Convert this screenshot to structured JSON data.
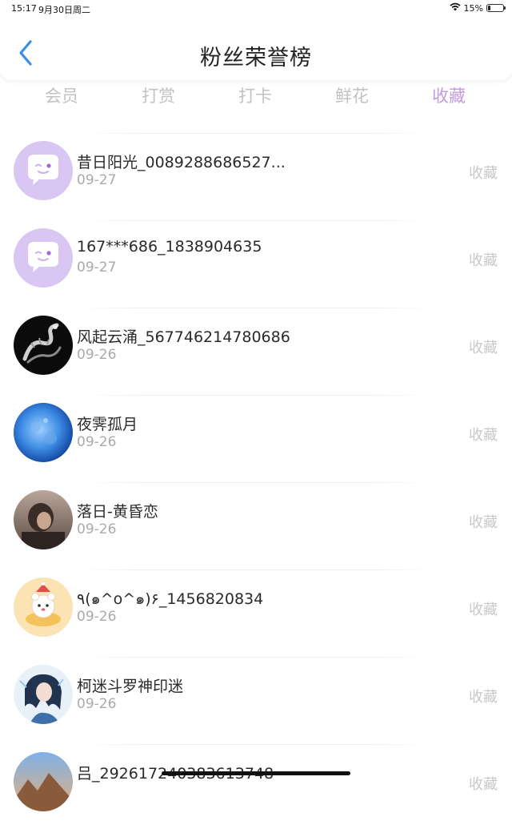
{
  "status_bar": {
    "time": "15:17",
    "date": "9月30日周二",
    "battery": "15%",
    "battery_level": 0.15
  },
  "header": {
    "title": "粉丝荣誉榜"
  },
  "tabs": [
    {
      "label": "会员"
    },
    {
      "label": "打赏"
    },
    {
      "label": "打卡"
    },
    {
      "label": "鲜花"
    },
    {
      "label": "收藏"
    }
  ],
  "active_tab": "收藏",
  "colors": {
    "accent": "#c39be0",
    "back_arrow": "#3a8ee6",
    "muted_text": "#c8c8c8"
  },
  "list": [
    {
      "name": "昔日阳光_0089288686527...",
      "date": "09-27",
      "action": "收藏",
      "avatar": "purple-chat-bubble-avatar"
    },
    {
      "name": "167***686_1838904635",
      "date": "09-27",
      "action": "收藏",
      "avatar": "purple-chat-bubble-avatar"
    },
    {
      "name": "风起云涌_567746214780686",
      "date": "09-26",
      "action": "收藏",
      "avatar": "dragon-avatar"
    },
    {
      "name": "夜霁孤月",
      "date": "09-26",
      "action": "收藏",
      "avatar": "moon-avatar"
    },
    {
      "name": "落日-黄昏恋",
      "date": "09-26",
      "action": "收藏",
      "avatar": "photo-avatar"
    },
    {
      "name": "٩(๑^o^๑)۶_1456820834",
      "date": "09-26",
      "action": "收藏",
      "avatar": "cartoon-bear-avatar"
    },
    {
      "name": "柯迷斗罗神印迷",
      "date": "09-26",
      "action": "收藏",
      "avatar": "anime-character-avatar"
    },
    {
      "name": "吕_292617240383613748",
      "date": "",
      "action": "收藏",
      "avatar": "landscape-avatar"
    }
  ]
}
